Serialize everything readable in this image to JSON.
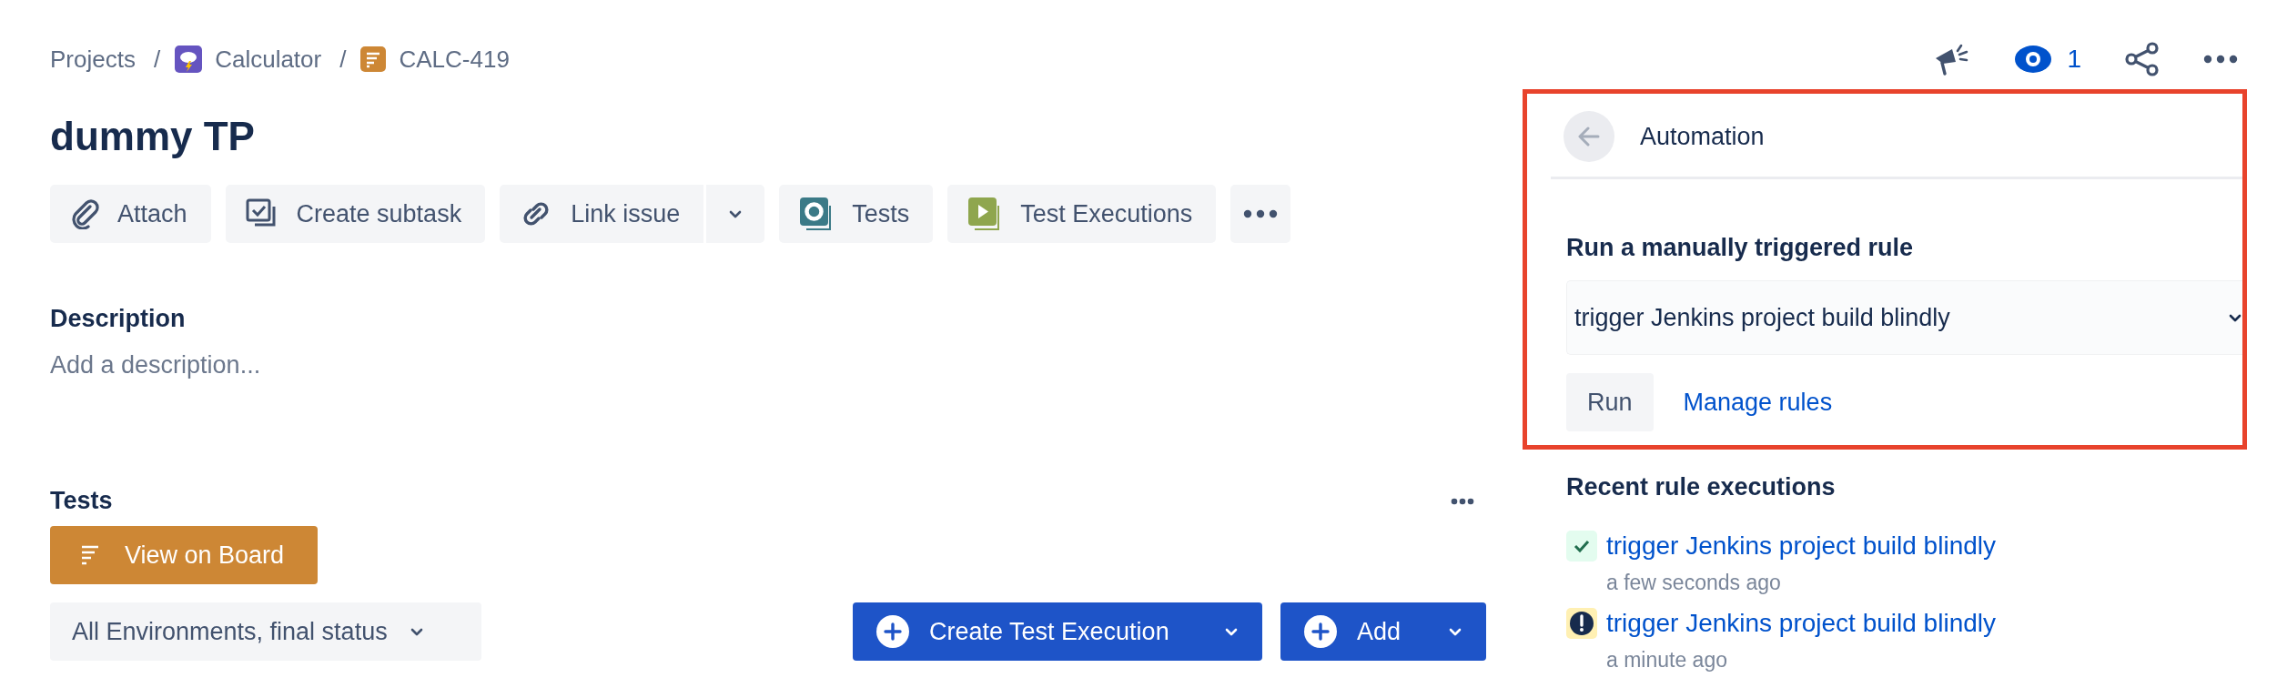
{
  "breadcrumbs": [
    {
      "kind": "plain",
      "label": "Projects"
    },
    {
      "separator": "/",
      "kind": "project",
      "label": "Calculator"
    },
    {
      "separator": "/",
      "kind": "issue",
      "label": "CALC-419"
    }
  ],
  "header_actions": {
    "watchers": "1"
  },
  "issue": {
    "title": "dummy TP"
  },
  "toolbar": [
    {
      "kind": "attach",
      "label": "Attach"
    },
    {
      "kind": "subtask",
      "label": "Create subtask"
    },
    {
      "kind": "link",
      "label": "Link issue"
    },
    {
      "kind": "tests",
      "label": "Tests"
    },
    {
      "kind": "executions",
      "label": "Test Executions"
    },
    {
      "kind": "more"
    }
  ],
  "description": {
    "heading": "Description",
    "placeholder": "Add a description..."
  },
  "tests": {
    "heading": "Tests",
    "board_button": "View on Board",
    "filter": "All Environments, final status",
    "create_button": "Create Test Execution",
    "add_button": "Add"
  },
  "automation": {
    "title": "Automation",
    "heading": "Run a manually triggered rule",
    "rule_select": "trigger Jenkins project build blindly",
    "run_button": "Run",
    "manage_link": "Manage rules"
  },
  "recent": {
    "heading": "Recent rule executions",
    "items": [
      {
        "kind": "success",
        "rule": "trigger Jenkins project build blindly",
        "time": "a few seconds ago"
      },
      {
        "kind": "warning",
        "rule": "trigger Jenkins project build blindly",
        "time": "a minute ago"
      }
    ]
  }
}
